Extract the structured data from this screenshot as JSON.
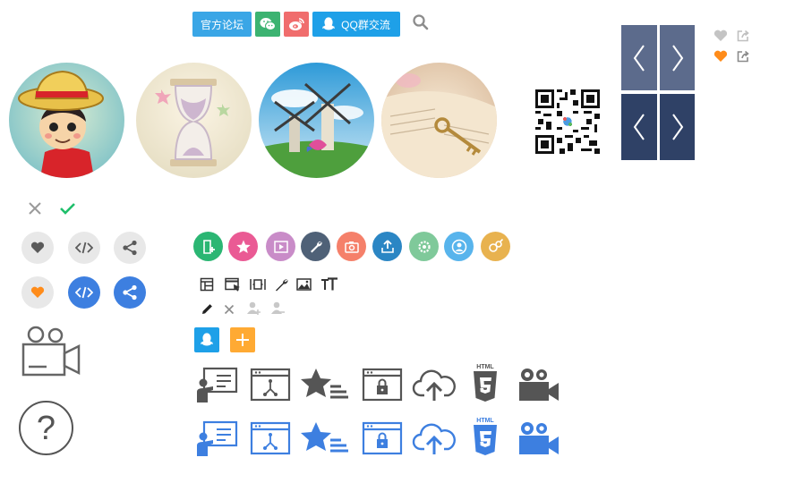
{
  "share_bar": {
    "forum_label": "官方论坛",
    "qq_group_label": "QQ群交流"
  },
  "help": {
    "symbol": "?"
  },
  "colors": {
    "blue_button": "#3aa6e6",
    "wechat_green": "#3cb371",
    "weibo_red": "#f06d6d",
    "nav_top": "#5c6b8c",
    "nav_bottom": "#2f4166",
    "orange": "#ff8c1a",
    "accent_blue": "#3d7fe0",
    "icon_gray": "#555555"
  },
  "icons": {
    "avatars": [
      "luffy-avatar",
      "hourglass-avatar",
      "windmill-avatar",
      "book-key-avatar"
    ],
    "round_actions": [
      "add-bookmark-icon",
      "star-icon",
      "video-icon",
      "wrench-icon",
      "camera-icon",
      "upload-icon",
      "settings-icon",
      "user-icon",
      "users-icon"
    ],
    "editor_tools": [
      "layout-icon",
      "window-pointer-icon",
      "fit-width-icon",
      "wrench-icon",
      "image-icon",
      "text-size-icon"
    ],
    "big_icons": [
      "presentation-icon",
      "sitemap-window-icon",
      "starred-list-icon",
      "secure-window-icon",
      "cloud-upload-icon",
      "html5-icon",
      "video-camera-icon"
    ]
  }
}
